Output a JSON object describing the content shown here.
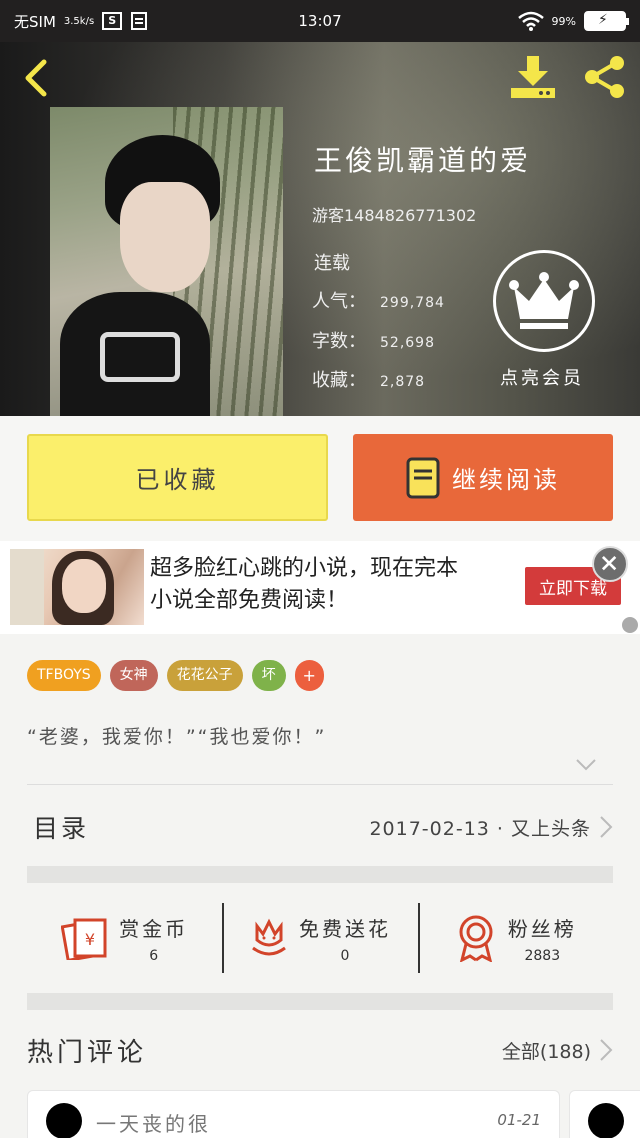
{
  "status_bar": {
    "carrier": "无SIM",
    "net_speed": "3.5k/s",
    "time": "13:07",
    "battery": "99%"
  },
  "book": {
    "title": "王俊凯霸道的爱",
    "author": "游客1484826771302",
    "status": "连载",
    "stats": [
      {
        "label": "人气：",
        "value": "299,784"
      },
      {
        "label": "字数：",
        "value": "52,698"
      },
      {
        "label": "收藏：",
        "value": "2,878"
      }
    ],
    "vip_label": "点亮会员"
  },
  "buttons": {
    "favorited": "已收藏",
    "continue_reading": "继续阅读"
  },
  "ad": {
    "line1": "超多脸红心跳的小说，现在完本",
    "line2": "小说全部免费阅读！",
    "cta": "立即下载"
  },
  "tags": [
    {
      "label": "TFBOYS",
      "color": "#f0a020"
    },
    {
      "label": "女神",
      "color": "#c0665a"
    },
    {
      "label": "花花公子",
      "color": "#c9a13a"
    },
    {
      "label": "坏",
      "color": "#7fb24a"
    },
    {
      "label": "+",
      "color": "#ec5f3e"
    }
  ],
  "blurb": "“老婆，我爱你！”“我也爱你！”",
  "toc": {
    "title": "目录",
    "update": "2017-02-13 · 又上头条"
  },
  "actions": [
    {
      "label": "赏金币",
      "value": "6",
      "icon": "red-envelope-icon"
    },
    {
      "label": "免费送花",
      "value": "0",
      "icon": "flower-icon"
    },
    {
      "label": "粉丝榜",
      "value": "2883",
      "icon": "medal-icon"
    }
  ],
  "comments": {
    "title": "热门评论",
    "all": "全部(188)",
    "first": {
      "text": "一天丧的很",
      "date": "01-21"
    }
  },
  "colors": {
    "accent_yellow": "#fbef6b",
    "accent_orange": "#e8683a",
    "icon_red": "#d2442a"
  }
}
